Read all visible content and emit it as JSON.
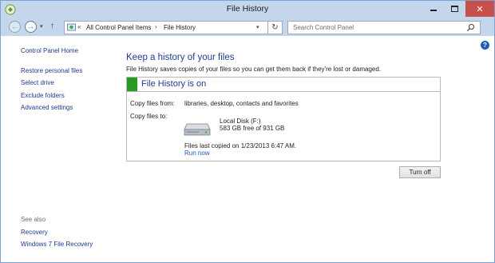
{
  "window": {
    "title": "File History",
    "controls": {
      "minimize": "minimize",
      "maximize": "maximize",
      "close": "✕"
    }
  },
  "nav": {
    "back": "back-arrow-icon",
    "forward": "forward-arrow-icon",
    "recent": "chevron-down-icon",
    "up": "up-arrow-icon",
    "breadcrumb_prefix": "«",
    "breadcrumbs": [
      "All Control Panel Items",
      "File History"
    ],
    "separator": "›",
    "dropdown": "▾",
    "refresh": "↻"
  },
  "search": {
    "placeholder": "Search Control Panel"
  },
  "help": {
    "label": "?"
  },
  "sidebar": {
    "home": "Control Panel Home",
    "links": [
      "Restore personal files",
      "Select drive",
      "Exclude folders",
      "Advanced settings"
    ],
    "see_also_label": "See also",
    "see_also": [
      "Recovery",
      "Windows 7 File Recovery"
    ]
  },
  "main": {
    "title": "Keep a history of your files",
    "description": "File History saves copies of your files so you can get them back if they're lost or damaged.",
    "status": {
      "title": "File History is on",
      "color": "#259b24"
    },
    "copy_from_label": "Copy files from:",
    "copy_from_value": "libraries, desktop, contacts and favorites",
    "copy_to_label": "Copy files to:",
    "drive_name": "Local Disk (F:)",
    "drive_free": "583 GB free of 931 GB",
    "last_copied": "Files last copied on 1/23/2013 6:47 AM.",
    "run_now": "Run now",
    "turn_off": "Turn off"
  },
  "colors": {
    "titlebar": "#c3d6ec",
    "close_button": "#c7504a",
    "link": "#1e3a8a",
    "heading": "#1e3d8f"
  }
}
